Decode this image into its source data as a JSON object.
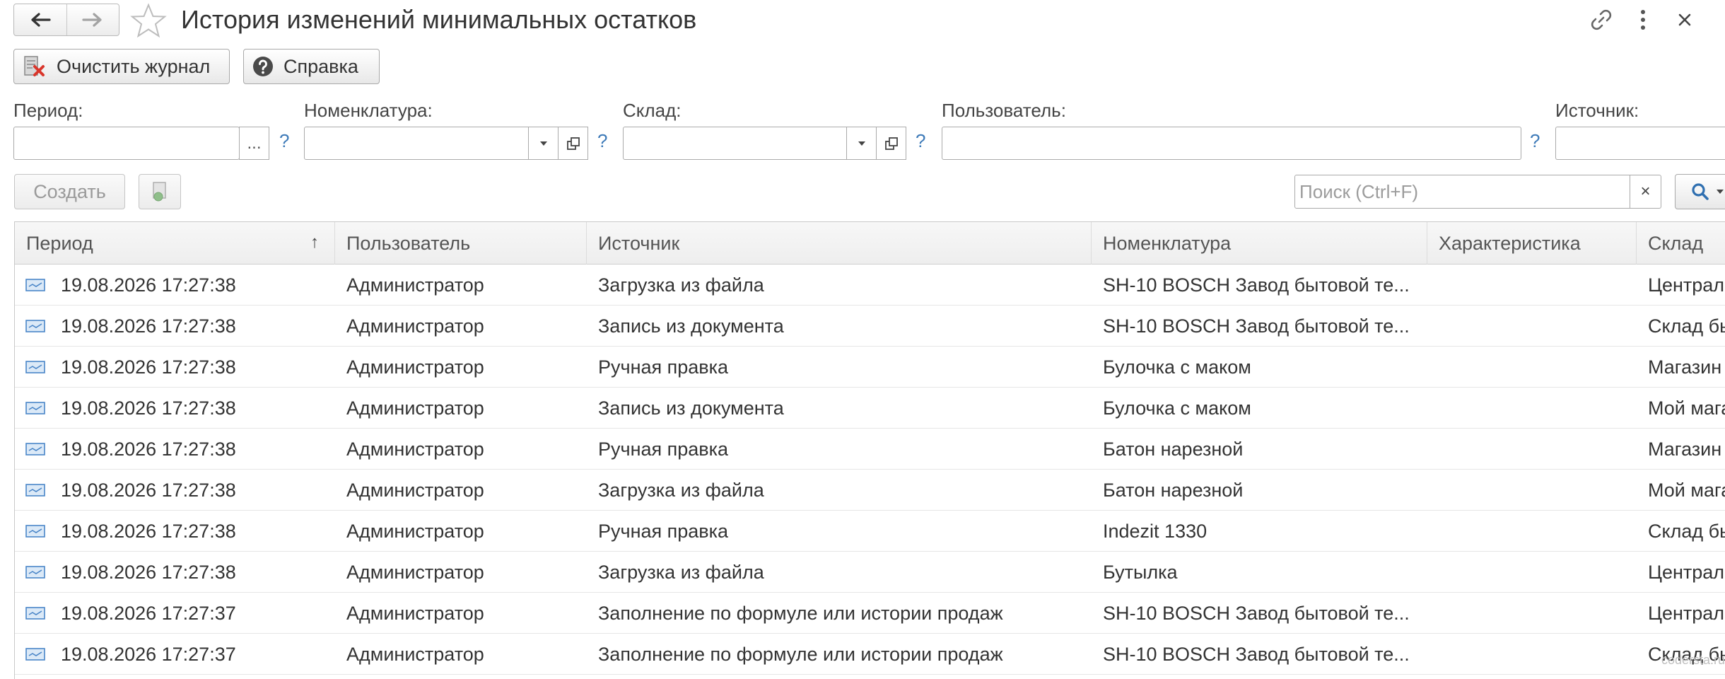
{
  "header": {
    "title": "История изменений минимальных остатков"
  },
  "commands": {
    "clear_log": "Очистить журнал",
    "help": "Справка"
  },
  "filters": {
    "period": {
      "label": "Период:",
      "value": "",
      "choose": "..."
    },
    "nomenclature": {
      "label": "Номенклатура:",
      "value": ""
    },
    "warehouse": {
      "label": "Склад:",
      "value": ""
    },
    "user": {
      "label": "Пользователь:",
      "value": ""
    },
    "source": {
      "label": "Источник:",
      "value": ""
    },
    "help_mark": "?"
  },
  "toolbar": {
    "create_label": "Создать",
    "search_placeholder": "Поиск (Ctrl+F)",
    "clear_glyph": "×"
  },
  "table": {
    "columns": [
      "Период",
      "Пользователь",
      "Источник",
      "Номенклатура",
      "Характеристика",
      "Склад"
    ],
    "sort_indicator": "↑",
    "rows": [
      {
        "period": "19.08.2026 17:27:38",
        "user": "Администратор",
        "source": "Загрузка из файла",
        "nomenclature": "SH-10 BOSCH Завод бытовой те...",
        "characteristic": "",
        "warehouse": "Централ"
      },
      {
        "period": "19.08.2026 17:27:38",
        "user": "Администратор",
        "source": "Запись из документа",
        "nomenclature": "SH-10 BOSCH Завод бытовой те...",
        "characteristic": "",
        "warehouse": "Склад бы"
      },
      {
        "period": "19.08.2026 17:27:38",
        "user": "Администратор",
        "source": "Ручная правка",
        "nomenclature": "Булочка с маком",
        "characteristic": "",
        "warehouse": "Магазин"
      },
      {
        "period": "19.08.2026 17:27:38",
        "user": "Администратор",
        "source": "Запись из документа",
        "nomenclature": "Булочка с маком",
        "characteristic": "",
        "warehouse": "Мой мага"
      },
      {
        "period": "19.08.2026 17:27:38",
        "user": "Администратор",
        "source": "Ручная правка",
        "nomenclature": "Батон нарезной",
        "characteristic": "",
        "warehouse": "Магазин"
      },
      {
        "period": "19.08.2026 17:27:38",
        "user": "Администратор",
        "source": "Загрузка из файла",
        "nomenclature": "Батон нарезной",
        "characteristic": "",
        "warehouse": "Мой мага"
      },
      {
        "period": "19.08.2026 17:27:38",
        "user": "Администратор",
        "source": "Ручная правка",
        "nomenclature": "Indezit 1330",
        "characteristic": "",
        "warehouse": "Склад бы"
      },
      {
        "period": "19.08.2026 17:27:38",
        "user": "Администратор",
        "source": "Загрузка из файла",
        "nomenclature": "Бутылка",
        "characteristic": "",
        "warehouse": "Централ"
      },
      {
        "period": "19.08.2026 17:27:37",
        "user": "Администратор",
        "source": "Заполнение по формуле или истории продаж",
        "nomenclature": "SH-10 BOSCH Завод бытовой те...",
        "characteristic": "",
        "warehouse": "Централ"
      },
      {
        "period": "19.08.2026 17:27:37",
        "user": "Администратор",
        "source": "Заполнение по формуле или истории продаж",
        "nomenclature": "SH-10 BOSCH Завод бытовой те...",
        "characteristic": "",
        "warehouse": "Склад бы"
      }
    ]
  },
  "watermark": "codersta.ru",
  "colors": {
    "accent_blue": "#3d7ab8",
    "row_icon": "#4a86c8",
    "clear_red": "#d9362b"
  }
}
